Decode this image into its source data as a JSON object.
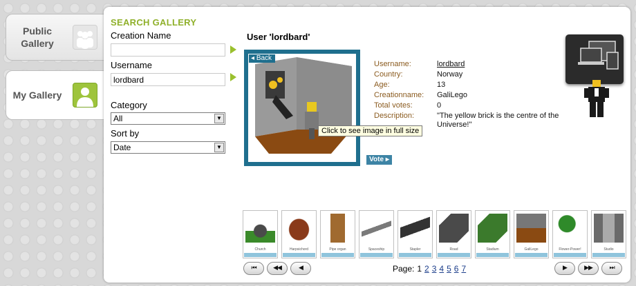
{
  "tabs": [
    {
      "label": "Public Gallery",
      "icon": "group-icon"
    },
    {
      "label": "My Gallery",
      "icon": "user-icon"
    }
  ],
  "search": {
    "title": "SEARCH GALLERY",
    "creation_name_label": "Creation Name",
    "creation_name_value": "",
    "username_label": "Username",
    "username_value": "lordbard",
    "category_label": "Category",
    "category_value": "All",
    "sort_label": "Sort by",
    "sort_value": "Date"
  },
  "detail": {
    "title": "User 'lordbard'",
    "back_label": "Back",
    "tooltip": "Click to see image in full size",
    "vote_label": "Vote",
    "fields": [
      {
        "key": "Username:",
        "value": "lordbard",
        "link": true
      },
      {
        "key": "Country:",
        "value": "Norway"
      },
      {
        "key": "Age:",
        "value": "13"
      },
      {
        "key": "Creationname:",
        "value": "GaliLego"
      },
      {
        "key": "Total votes:",
        "value": "0"
      },
      {
        "key": "Description:",
        "value": "\"The yellow brick is the centre of the Universe!\""
      }
    ]
  },
  "thumbnails": [
    {
      "name": "Church",
      "color": "#3a8a2a"
    },
    {
      "name": "Harpsichord",
      "color": "#8a3a1a"
    },
    {
      "name": "Pipe organ",
      "color": "#a06a30"
    },
    {
      "name": "Spaceship",
      "color": "#7a7a7a"
    },
    {
      "name": "Stapler",
      "color": "#333333"
    },
    {
      "name": "Road",
      "color": "#4a4a4a"
    },
    {
      "name": "Stadium",
      "color": "#3b7a2c"
    },
    {
      "name": "GaliLego",
      "color": "#777777"
    },
    {
      "name": "Flower-Power!",
      "color": "#2f8a2a"
    },
    {
      "name": "Studio",
      "color": "#6a6a6a"
    }
  ],
  "pager": {
    "label": "Page:",
    "current": "1",
    "pages": [
      "2",
      "3",
      "4",
      "5",
      "6",
      "7"
    ]
  },
  "nav": {
    "first": "⏮",
    "prev_fast": "◀◀",
    "prev": "◀",
    "next": "▶",
    "next_fast": "▶▶",
    "last": "⏭"
  }
}
